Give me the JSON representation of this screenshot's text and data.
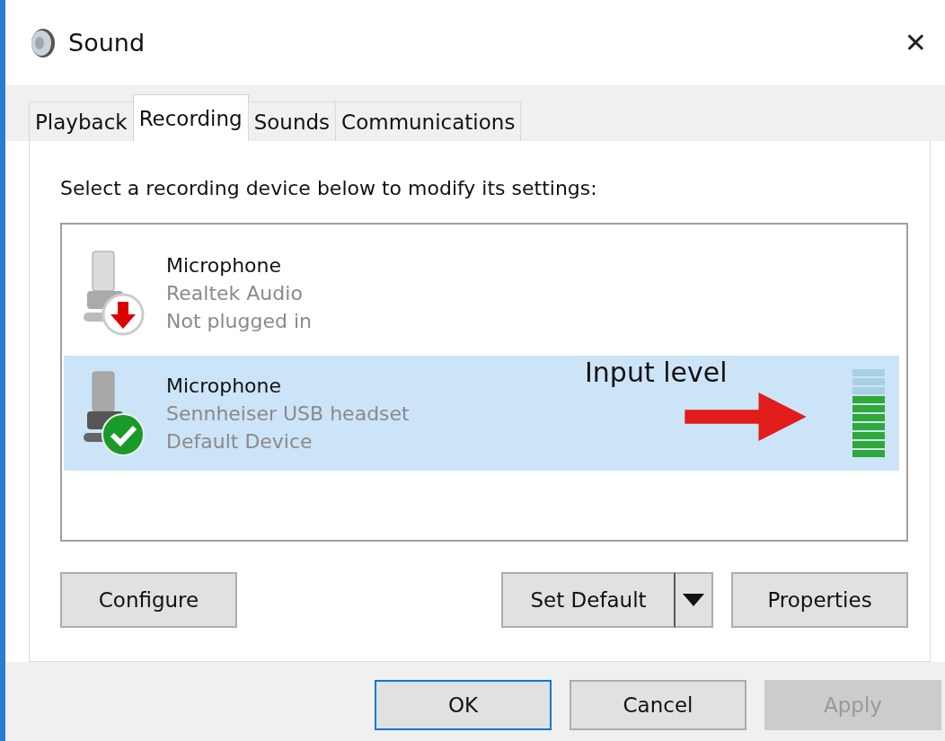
{
  "window": {
    "title": "Sound",
    "close": "✕"
  },
  "tabs": [
    {
      "label": "Playback",
      "selected": false
    },
    {
      "label": "Recording",
      "selected": true
    },
    {
      "label": "Sounds",
      "selected": false
    },
    {
      "label": "Communications",
      "selected": false
    }
  ],
  "instruction": "Select a recording device below to modify its settings:",
  "devices": [
    {
      "name": "Microphone",
      "driver": "Realtek Audio",
      "status": "Not plugged in",
      "kind": "unplugged",
      "selected": false
    },
    {
      "name": "Microphone",
      "driver": "Sennheiser USB headset",
      "status": "Default Device",
      "kind": "default",
      "selected": true,
      "level": 0.7
    }
  ],
  "annotation": {
    "label": "Input level"
  },
  "panel_buttons": [
    {
      "label": "Configure",
      "kind": "plain"
    },
    {
      "label": "Set Default",
      "kind": "split"
    },
    {
      "label": "Properties",
      "kind": "plain"
    }
  ],
  "buttons": [
    {
      "label": "OK",
      "focused": true,
      "disabled": false
    },
    {
      "label": "Cancel",
      "focused": false,
      "disabled": false
    },
    {
      "label": "Apply",
      "focused": false,
      "disabled": true
    }
  ]
}
